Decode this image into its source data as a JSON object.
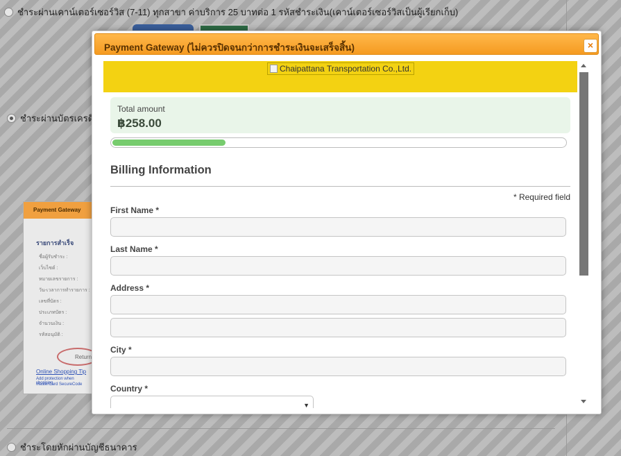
{
  "background": {
    "option_counter_service": "ชำระผ่านเคาน์เตอร์เซอร์วิส (7-11) ทุกสาขา ค่าบริการ 25 บาทต่อ 1 รหัสชำระเงิน(เคาน์เตอร์เซอร์วิสเป็นผู้เรียกเก็บ)",
    "option_credit_card": "ชำระผ่านบัตรเครดิต",
    "option_bank_account": "ชำระโดยหักผ่านบัญชีธนาคาร",
    "example_image": {
      "header": "Payment Gateway",
      "title": "รายการสำเร็จ",
      "rows": [
        "ชื่อผู้รับชำระ :",
        "เว็บไซต์ :",
        "หมายเลขรายการ :",
        "วัน-เวลาการทำรายการ :",
        "เลขที่บัตร :",
        "ประเภทบัตร :",
        "จำนวนเงิน :",
        "รหัสอนุมัติ :"
      ],
      "return_button": "Return",
      "link_text": "Online Shopping Tip",
      "small_line_1": "Add protection when shopping",
      "small_line_2": "MasterCard SecureCode"
    }
  },
  "modal": {
    "title": "Payment Gateway (ไม่ควรปิดจนกว่าการชำระเงินจะเสร็จสิ้น)",
    "close_icon": "close-icon",
    "merchant_logo_alt": "Chaipattana Transportation Co.,Ltd.",
    "amount_label": "Total amount",
    "amount_value": "฿258.00",
    "progress_fraction": 0.25,
    "section_title": "Billing Information",
    "required_note": "* Required field",
    "fields": {
      "first_name": {
        "label": "First Name *",
        "value": ""
      },
      "last_name": {
        "label": "Last Name *",
        "value": ""
      },
      "address": {
        "label": "Address *",
        "value_line1": "",
        "value_line2": ""
      },
      "city": {
        "label": "City *",
        "value": ""
      },
      "country": {
        "label": "Country *",
        "selected": ""
      }
    }
  },
  "colors": {
    "header_orange": "#f59b21",
    "banner_yellow": "#f3d212",
    "amount_bg": "#e9f5e9",
    "progress_green": "#77cc6e"
  }
}
